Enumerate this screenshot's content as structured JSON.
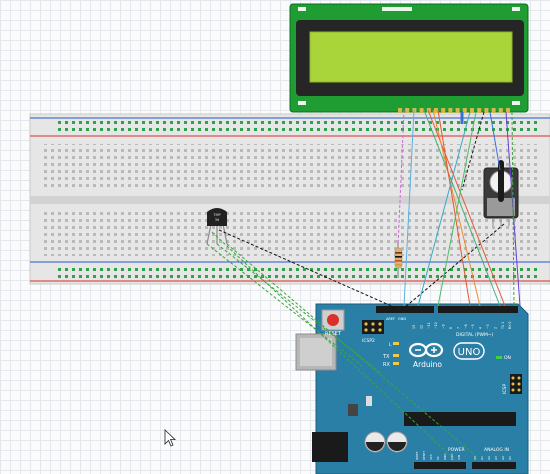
{
  "lcd": {
    "pin_count": 16
  },
  "sensor": {
    "label_line1": "TMP",
    "label_line2": "36"
  },
  "arduino": {
    "model": "UNO",
    "brand": "Arduino",
    "reset_label": "RESET",
    "icsp_top": "ICSP2",
    "icsp_side": "ICSP",
    "tx_label": "TX",
    "rx_label": "RX",
    "on_label": "ON",
    "l_label": "L",
    "digital_header": "DIGITAL (PWM~)",
    "aref_label": "AREF",
    "gnd_label": "GND",
    "power_header": "POWER",
    "analog_header": "ANALOG IN",
    "digital_pins": [
      "13",
      "12",
      "~11",
      "~10",
      "~9",
      "8",
      "7",
      "~6",
      "~5",
      "4",
      "~3",
      "2",
      "TX 1",
      "RX 0"
    ],
    "power_pins": [
      "IOREF",
      "RESET",
      "3V3",
      "5V",
      "GND",
      "GND",
      "VIN"
    ],
    "analog_pins": [
      "A0",
      "A1",
      "A2",
      "A3",
      "A4",
      "A5"
    ]
  },
  "colors": {
    "board": "#2a7fa6",
    "lcd_frame": "#1f9d33",
    "lcd_screen": "#a9d43a",
    "breadboard": "#e8e8e8",
    "rail_red": "#d9534f",
    "rail_blue": "#4a76c9"
  }
}
